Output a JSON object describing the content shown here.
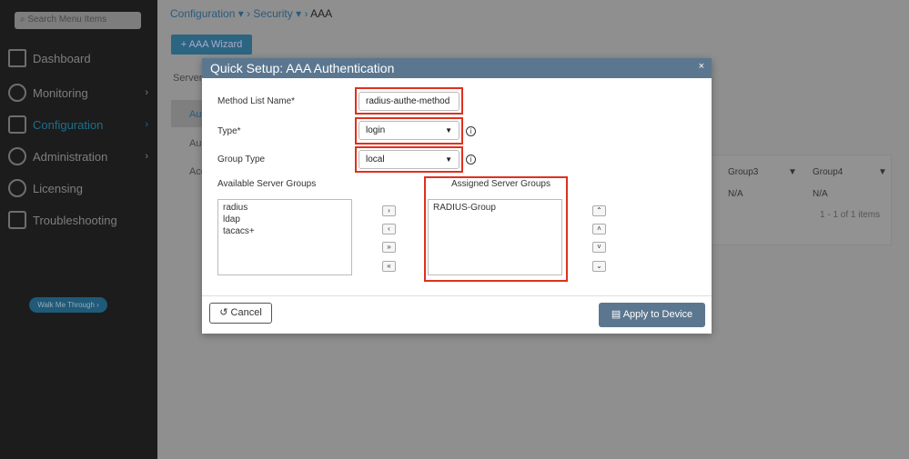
{
  "sidebar": {
    "search_placeholder": "Search Menu Items",
    "items": [
      {
        "label": "Dashboard",
        "icon": "dashboard-icon"
      },
      {
        "label": "Monitoring",
        "icon": "gauge-icon"
      },
      {
        "label": "Configuration",
        "icon": "wrench-icon"
      },
      {
        "label": "Administration",
        "icon": "gear-icon"
      },
      {
        "label": "Licensing",
        "icon": "license-icon"
      },
      {
        "label": "Troubleshooting",
        "icon": "tools-icon"
      }
    ],
    "walk_me": "Walk Me Through ›"
  },
  "breadcrumb": {
    "c1": "Configuration",
    "c2": "Security",
    "c3": "AAA"
  },
  "wizard_label": "+ AAA Wizard",
  "bg": {
    "servers": "Server",
    "aut1": "Aut",
    "aut2": "Aut",
    "acc": "Acc",
    "group3": "Group3",
    "group4": "Group4",
    "na1": "N/A",
    "na2": "N/A",
    "pager": "1 - 1 of 1 items"
  },
  "modal": {
    "title": "Quick Setup: AAA Authentication",
    "close": "×",
    "method_label": "Method List Name*",
    "method_value": "radius-authe-method",
    "type_label": "Type*",
    "type_value": "login",
    "group_type_label": "Group Type",
    "group_type_value": "local",
    "available_label": "Available Server Groups",
    "available": [
      "radius",
      "ldap",
      "tacacs+"
    ],
    "assigned_label": "Assigned Server Groups",
    "assigned": [
      "RADIUS-Group"
    ],
    "cancel": "Cancel",
    "apply": "Apply to Device"
  },
  "colors": {
    "highlight": "#e0301e",
    "accent": "#5b7790"
  }
}
